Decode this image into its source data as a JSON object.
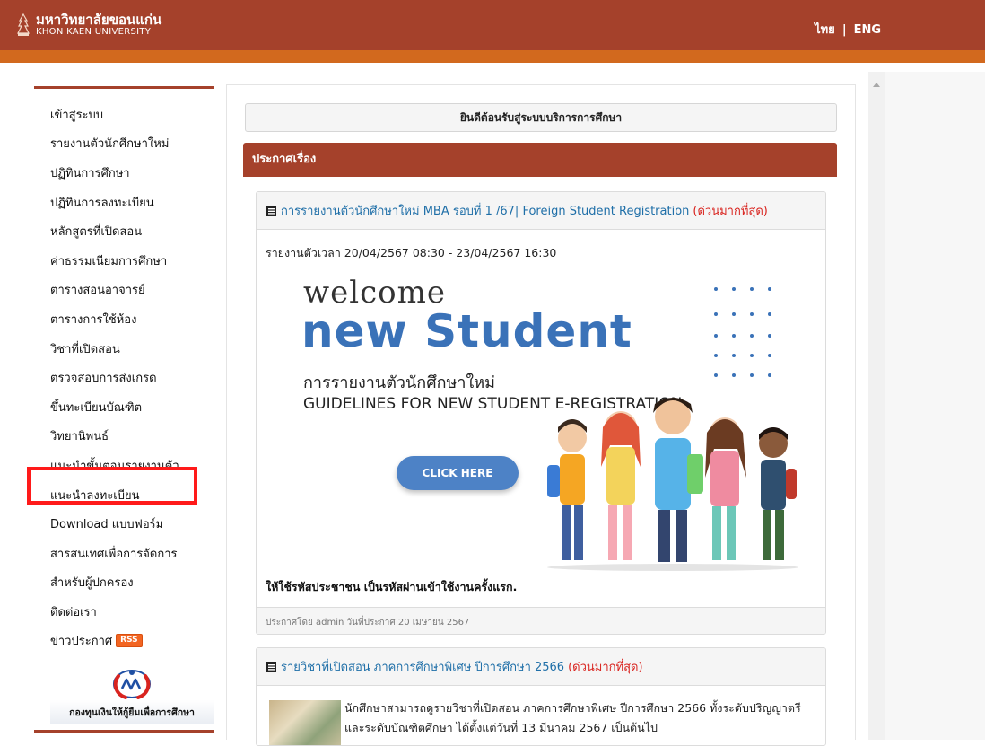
{
  "header": {
    "logo_th": "มหาวิทยาลัยขอนแก่น",
    "logo_en": "KHON KAEN UNIVERSITY",
    "lang_th": "ไทย",
    "lang_sep": "|",
    "lang_en": "ENG"
  },
  "sidebar": {
    "items": [
      {
        "label": "เข้าสู่ระบบ"
      },
      {
        "label": "รายงานตัวนักศึกษาใหม่"
      },
      {
        "label": "ปฏิทินการศึกษา"
      },
      {
        "label": "ปฏิทินการลงทะเบียน"
      },
      {
        "label": "หลักสูตรที่เปิดสอน"
      },
      {
        "label": "ค่าธรรมเนียมการศึกษา"
      },
      {
        "label": "ตารางสอนอาจารย์"
      },
      {
        "label": "ตารางการใช้ห้อง"
      },
      {
        "label": "วิชาที่เปิดสอน"
      },
      {
        "label": "ตรวจสอบการส่งเกรด"
      },
      {
        "label": "ขึ้นทะเบียนบัณฑิต"
      },
      {
        "label": "วิทยานิพนธ์"
      },
      {
        "label": "แนะนำขั้นตอนรายงานตัว"
      },
      {
        "label": "แนะนำลงทะเบียน"
      },
      {
        "label": "Download แบบฟอร์ม"
      },
      {
        "label": "สารสนเทศเพื่อการจัดการ"
      },
      {
        "label": "สำหรับผู้ปกครอง"
      },
      {
        "label": "ติดต่อเรา"
      },
      {
        "label": "ข่าวประกาศ",
        "badge": "RSS"
      }
    ],
    "loan_text": "กองทุนเงินให้กู้ยืมเพื่อการศึกษา"
  },
  "main": {
    "welcome": "ยินดีต้อนรับสู่ระบบบริการการศึกษา",
    "announce_title": "ประกาศเรื่อง",
    "card1": {
      "title": "การรายงานตัวนักศึกษาใหม่ MBA รอบที่ 1 /67| Foreign Student Registration",
      "urgent": "(ด่วนมากที่สุด)",
      "period": "รายงานตัวเวลา 20/04/2567 08:30 - 23/04/2567 16:30",
      "banner": {
        "welcome": "welcome",
        "new_student": "new Student",
        "th_line": "การรายงานตัวนักศึกษาใหม่",
        "en_line": "GUIDELINES FOR NEW STUDENT E-REGISTRATION.",
        "button": "CLICK HERE"
      },
      "note": "ให้ใช้รหัสประชาชน เป็นรหัสผ่านเข้าใช้งานครั้งแรก.",
      "footer": "ประกาศโดย  admin  วันที่ประกาศ  20 เมษายน 2567"
    },
    "card2": {
      "title": "รายวิชาที่เปิดสอน ภาคการศึกษาพิเศษ ปีการศึกษา 2566",
      "urgent": "(ด่วนมากที่สุด)",
      "text": "นักศึกษาสามารถดูรายวิชาที่เปิดสอน ภาคการศึกษาพิเศษ ปีการศึกษา 2566 ทั้งระดับปริญญาตรีและระดับบัณฑิตศึกษา ได้ตั้งแต่วันที่ 13 มีนาคม 2567 เป็นต้นไป"
    }
  },
  "colors": {
    "header": "#a5412b",
    "header_stripe": "#d2691e",
    "link": "#1f6fa8",
    "urgent": "#d9241f",
    "highlight": "#ff1a1a"
  }
}
